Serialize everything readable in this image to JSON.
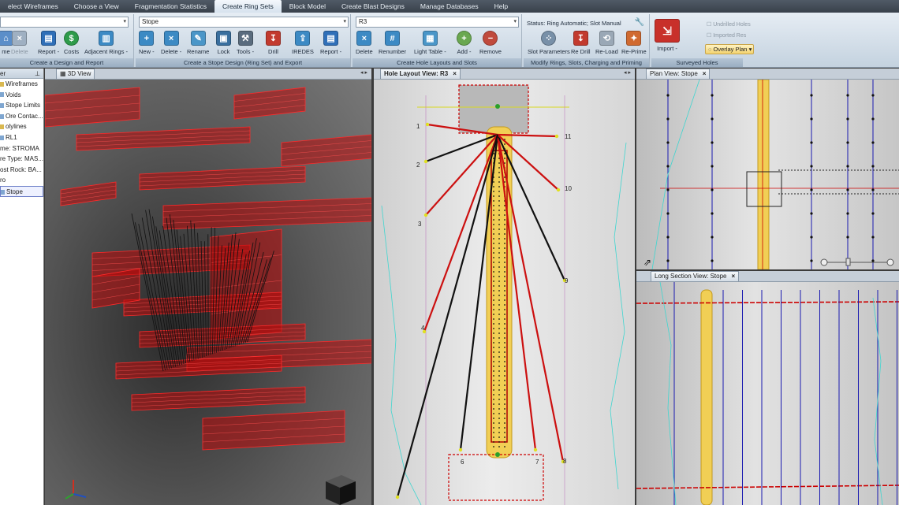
{
  "menubar": {
    "tabs": [
      "elect Wireframes",
      "Choose a View",
      "Fragmentation Statistics",
      "Create Ring Sets",
      "Block Model",
      "Create Blast Designs",
      "Manage Databases",
      "Help"
    ],
    "active_index": 3
  },
  "ribbon": {
    "wire_group": {
      "label": "Create a Design and Report",
      "buttons": [
        {
          "label": "me"
        },
        {
          "label": "Delete"
        },
        {
          "label": "Report -"
        },
        {
          "label": "Costs"
        },
        {
          "label": "Adjacent Rings -"
        }
      ]
    },
    "stope_group": {
      "label": "Create a Stope Design (Ring Set) and Export",
      "combo_value": "Stope",
      "buttons": [
        {
          "label": "New -"
        },
        {
          "label": "Delete -"
        },
        {
          "label": "Rename"
        },
        {
          "label": "Lock"
        },
        {
          "label": "Tools -"
        },
        {
          "label": "Drill"
        },
        {
          "label": "IREDES"
        },
        {
          "label": "Report -"
        }
      ]
    },
    "hole_group": {
      "label": "Create Hole Layouts and Slots",
      "combo_value": "R3",
      "buttons": [
        {
          "label": "Delete"
        },
        {
          "label": "Renumber"
        },
        {
          "label": "Light Table -"
        },
        {
          "label": "Add -"
        },
        {
          "label": "Remove"
        }
      ]
    },
    "modify_group": {
      "label": "Modify Rings, Slots, Charging and Priming",
      "status": "Status: Ring Automatic; Slot Manual",
      "buttons": [
        {
          "label": "Slot Parameters"
        },
        {
          "label": "Re Drill"
        },
        {
          "label": "Re-Load"
        },
        {
          "label": "Re-Prime"
        }
      ]
    },
    "surveyed_group": {
      "label": "Surveyed Holes",
      "import_label": "Import -",
      "items": [
        "Undrilled Holes",
        "Imported Res"
      ],
      "overlay_label": "Overlay Plan"
    }
  },
  "tree": {
    "header": "er",
    "items": [
      {
        "label": "Wireframes",
        "icon": "folder-icon"
      },
      {
        "label": "Voids",
        "icon": "wireframe-icon"
      },
      {
        "label": "Stope Limits",
        "icon": "wireframe-icon"
      },
      {
        "label": "Ore Contac...",
        "icon": "wireframe-icon"
      },
      {
        "label": "olylines",
        "icon": "folder-icon"
      },
      {
        "label": "RL1",
        "icon": "polyline-icon"
      },
      {
        "label": "me: STROMA",
        "icon": "none"
      },
      {
        "label": "re Type: MAS...",
        "icon": "none"
      },
      {
        "label": "ost Rock: BA...",
        "icon": "none"
      },
      {
        "label": "ro",
        "icon": "none"
      },
      {
        "label": "Stope",
        "icon": "stope-icon",
        "selected": true
      }
    ]
  },
  "views": {
    "view3d": {
      "tab": "3D View"
    },
    "hole_layout": {
      "tab": "Hole Layout View: R3",
      "hole_numbers": [
        "1",
        "2",
        "3",
        "4",
        "6",
        "7",
        "8",
        "9",
        "10",
        "11"
      ]
    },
    "plan": {
      "tab": "Plan View: Stope"
    },
    "long_section": {
      "tab": "Long Section View: Stope"
    }
  },
  "colors": {
    "accent": "#cc0000",
    "ore": "#f5c842",
    "blue_line": "#1a1ab0",
    "cyan": "#3fd6d0"
  }
}
